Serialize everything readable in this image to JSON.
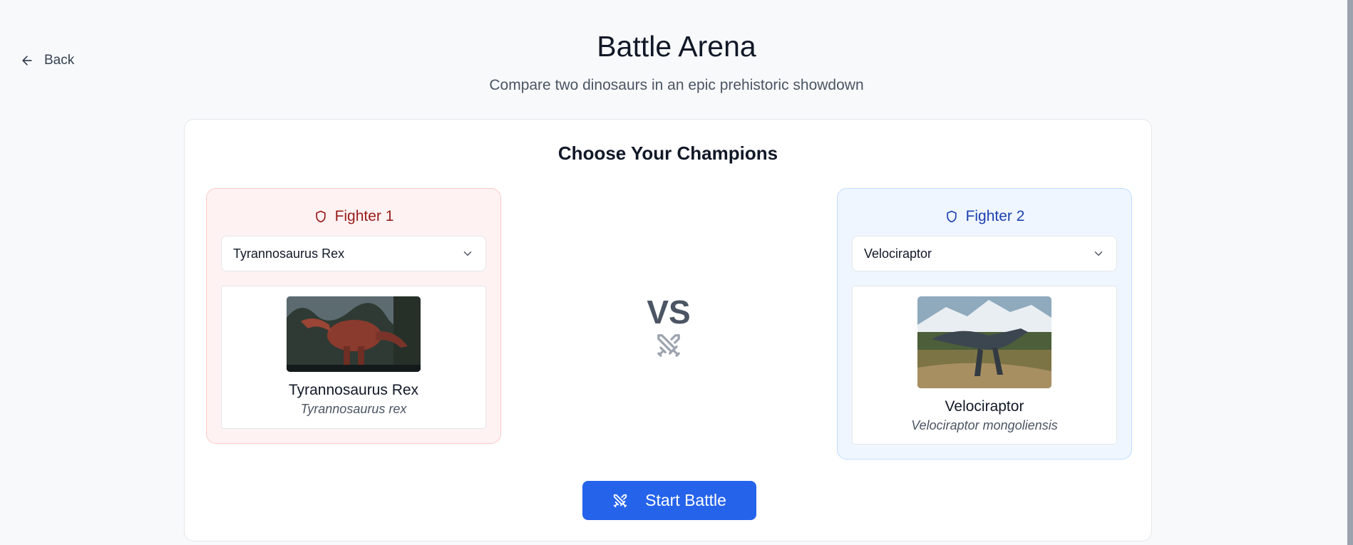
{
  "nav": {
    "back_label": "Back"
  },
  "header": {
    "title": "Battle Arena",
    "subtitle": "Compare two dinosaurs in an epic prehistoric showdown"
  },
  "card": {
    "title": "Choose Your Champions"
  },
  "fighters": [
    {
      "label": "Fighter 1",
      "selected": "Tyrannosaurus Rex",
      "name": "Tyrannosaurus Rex",
      "scientific": "Tyrannosaurus rex",
      "accent": "#991b1b"
    },
    {
      "label": "Fighter 2",
      "selected": "Velociraptor",
      "name": "Velociraptor",
      "scientific": "Velociraptor mongoliensis",
      "accent": "#1e40af"
    }
  ],
  "vs": "VS",
  "actions": {
    "start_label": "Start Battle",
    "color": "#2563eb"
  }
}
